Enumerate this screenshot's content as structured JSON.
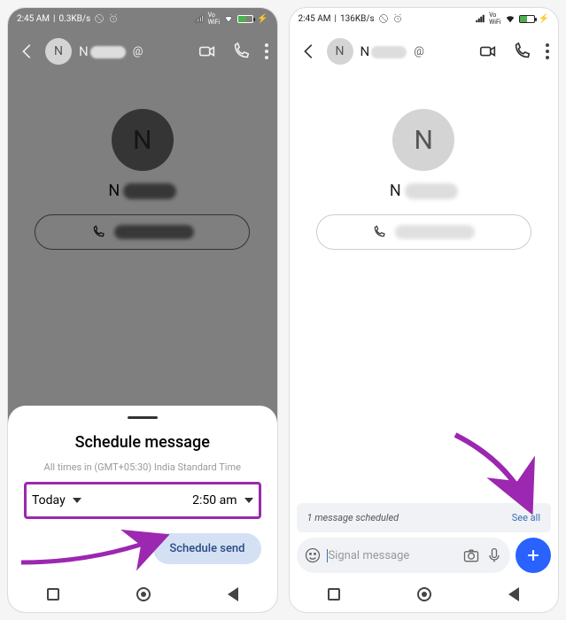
{
  "left": {
    "status": {
      "time": "2:45 AM",
      "speed": "0.3KB/s"
    },
    "contact": {
      "initial": "N",
      "name_first": "N"
    },
    "sheet": {
      "title": "Schedule message",
      "subtitle": "All times in (GMT+05:30) India Standard Time",
      "day": "Today",
      "time": "2:50 am",
      "button": "Schedule send"
    }
  },
  "right": {
    "status": {
      "time": "2:45 AM",
      "speed": "136KB/s"
    },
    "contact": {
      "initial": "N",
      "name_first": "N"
    },
    "banner": {
      "text": "1 message scheduled",
      "link": "See all"
    },
    "composer": {
      "placeholder": "Signal message"
    }
  }
}
